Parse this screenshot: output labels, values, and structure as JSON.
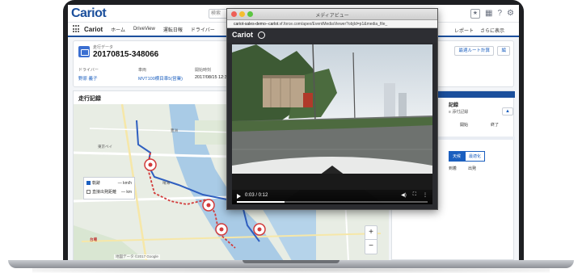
{
  "app": {
    "logo": "Cariot",
    "search_placeholder": "検索",
    "header_icons": [
      "★",
      "▦",
      "?",
      "⚙"
    ]
  },
  "nav": {
    "app_name": "Cariot",
    "items": [
      "ホーム",
      "DriveView",
      "運転日報",
      "ドライバー"
    ],
    "right_items": [
      "レポート",
      "さらに表示"
    ]
  },
  "record": {
    "type_label": "走行データ",
    "name": "20170815-348066",
    "buttons": [
      "最適ルート計算",
      "編"
    ],
    "fields": [
      {
        "label": "ドライバー",
        "value": "野原 義子",
        "link": true
      },
      {
        "label": "車両",
        "value": "MVT100横目車5(営業)",
        "link": true
      },
      {
        "label": "開始時刻",
        "value": "2017/08/15 12:33",
        "link": false
      }
    ]
  },
  "map_panel": {
    "title": "走行記録",
    "legend": [
      {
        "label": "軌跡",
        "value": "— km/h",
        "checked": true
      },
      {
        "label": "直接出発距離",
        "value": "— km",
        "checked": false
      }
    ],
    "labels": [
      "東京ベイ",
      "豊洲",
      "晴海",
      "有明",
      "台場"
    ],
    "zoom_in": "+",
    "zoom_out": "−",
    "footer": "地図データ ©2017 Google"
  },
  "right_panel": {
    "title": "記録",
    "subtitle": "≡ 添付記録",
    "pill": "▲",
    "filters": [
      "開始",
      "終了"
    ],
    "toggle_on": "天候",
    "toggle_off": "最適化",
    "cols": [
      "到着",
      "出発"
    ]
  },
  "media_viewer": {
    "title": "メディアビュー",
    "url_domain": "cariot-sales-demo--carlot",
    "url_rest": ".vf.force.com/apex/EventMediaViewer?objId=p1&media_file_",
    "brand": "Cariot",
    "time": "0:03 / 0:12",
    "progress": 0.25,
    "controls_right": [
      "◀)",
      "⛶",
      "⋮"
    ]
  },
  "colors": {
    "brand_blue": "#1b4f9c",
    "link_blue": "#1b5fbf",
    "route_red": "#d23a3a",
    "route_blue": "#2f5fc0"
  }
}
